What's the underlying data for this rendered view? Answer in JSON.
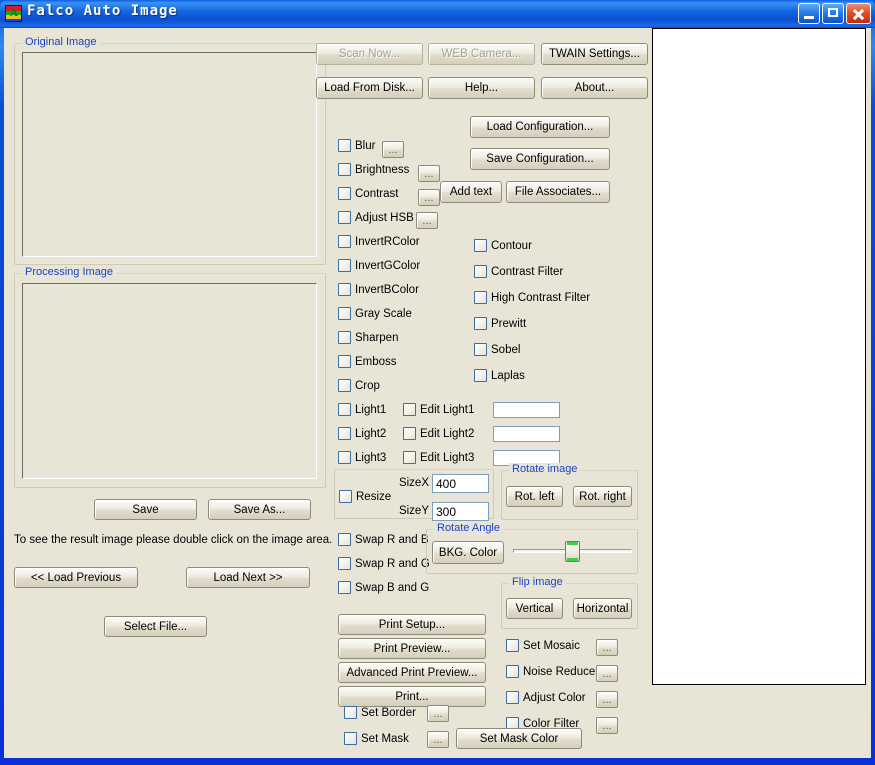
{
  "window": {
    "title": "Falco Auto Image",
    "icon": "app-icon",
    "minimize_label": "Minimize",
    "maximize_label": "Maximize",
    "close_label": "Close",
    "titlebar_color": "#0831d9",
    "client_color": "#e9e5d6"
  },
  "left": {
    "original_group": "Original Image",
    "processing_group": "Processing Image",
    "save": "Save",
    "save_as": "Save As...",
    "hint": "To see the result image please double click on the image area.",
    "load_previous": "<< Load Previous",
    "load_next": "Load Next >>",
    "select_file": "Select File..."
  },
  "toolbar": {
    "scan_now": "Scan Now...",
    "web_camera": "WEB Camera...",
    "twain_settings": "TWAIN Settings...",
    "load_from_disk": "Load From Disk...",
    "help": "Help...",
    "about": "About...",
    "scan_now_enabled": false,
    "web_camera_enabled": false
  },
  "config": {
    "load_configuration": "Load Configuration...",
    "save_configuration": "Save Configuration...",
    "add_text": "Add text",
    "file_associates": "File Associates..."
  },
  "effects_col1": [
    {
      "label": "Blur",
      "checked": false,
      "more": "..."
    },
    {
      "label": "Brightness",
      "checked": false,
      "more": "..."
    },
    {
      "label": "Contrast",
      "checked": false,
      "more": "..."
    },
    {
      "label": "Adjust HSB",
      "checked": false,
      "more": "..."
    },
    {
      "label": "InvertRColor",
      "checked": false
    },
    {
      "label": "InvertGColor",
      "checked": false
    },
    {
      "label": "InvertBColor",
      "checked": false
    },
    {
      "label": "Gray Scale",
      "checked": false
    },
    {
      "label": "Sharpen",
      "checked": false
    },
    {
      "label": "Emboss",
      "checked": false
    },
    {
      "label": "Crop",
      "checked": false
    }
  ],
  "effects_col2": [
    {
      "label": "Contour",
      "checked": false
    },
    {
      "label": "Contrast Filter",
      "checked": false
    },
    {
      "label": "High Contrast Filter",
      "checked": false
    },
    {
      "label": "Prewitt",
      "checked": false
    },
    {
      "label": "Sobel",
      "checked": false
    },
    {
      "label": "Laplas",
      "checked": false
    }
  ],
  "lights": [
    {
      "light": "Light1",
      "edit": "Edit Light1",
      "value": "",
      "checked": false,
      "edit_checked": false
    },
    {
      "light": "Light2",
      "edit": "Edit Light2",
      "value": "",
      "checked": false,
      "edit_checked": false
    },
    {
      "light": "Light3",
      "edit": "Edit Light3",
      "value": "",
      "checked": false,
      "edit_checked": false
    }
  ],
  "resize": {
    "checkbox": "Resize",
    "checked": false,
    "sizex_label": "SizeX",
    "sizex_value": "400",
    "sizey_label": "SizeY",
    "sizey_value": "300"
  },
  "rotate_image": {
    "title": "Rotate image",
    "rot_left": "Rot. left",
    "rot_right": "Rot. right"
  },
  "rotate_angle": {
    "title": "Rotate Angle",
    "bkg_color": "BKG. Color",
    "slider_value": 50,
    "accent": "#3fcf3f"
  },
  "swaps": [
    {
      "label": "Swap R and B",
      "checked": false
    },
    {
      "label": "Swap R and G",
      "checked": false
    },
    {
      "label": "Swap B and G",
      "checked": false
    }
  ],
  "flip_image": {
    "title": "Flip image",
    "vertical": "Vertical",
    "horizontal": "Horizontal"
  },
  "print": {
    "print_setup": "Print Setup...",
    "print_preview": "Print Preview...",
    "advanced_print_preview": "Advanced Print Preview...",
    "print": "Print..."
  },
  "filters": [
    {
      "label": "Set Mosaic",
      "checked": false,
      "more": "..."
    },
    {
      "label": "Noise Reduce",
      "checked": false,
      "more": "..."
    },
    {
      "label": "Adjust Color",
      "checked": false,
      "more": "..."
    },
    {
      "label": "Color Filter",
      "checked": false,
      "more": "..."
    }
  ],
  "border_mask": {
    "set_border": "Set Border",
    "set_border_more": "...",
    "set_mask": "Set Mask",
    "set_mask_more": "...",
    "set_mask_color": "Set Mask Color"
  },
  "preview": {
    "name": "result-preview-panel",
    "content": ""
  }
}
